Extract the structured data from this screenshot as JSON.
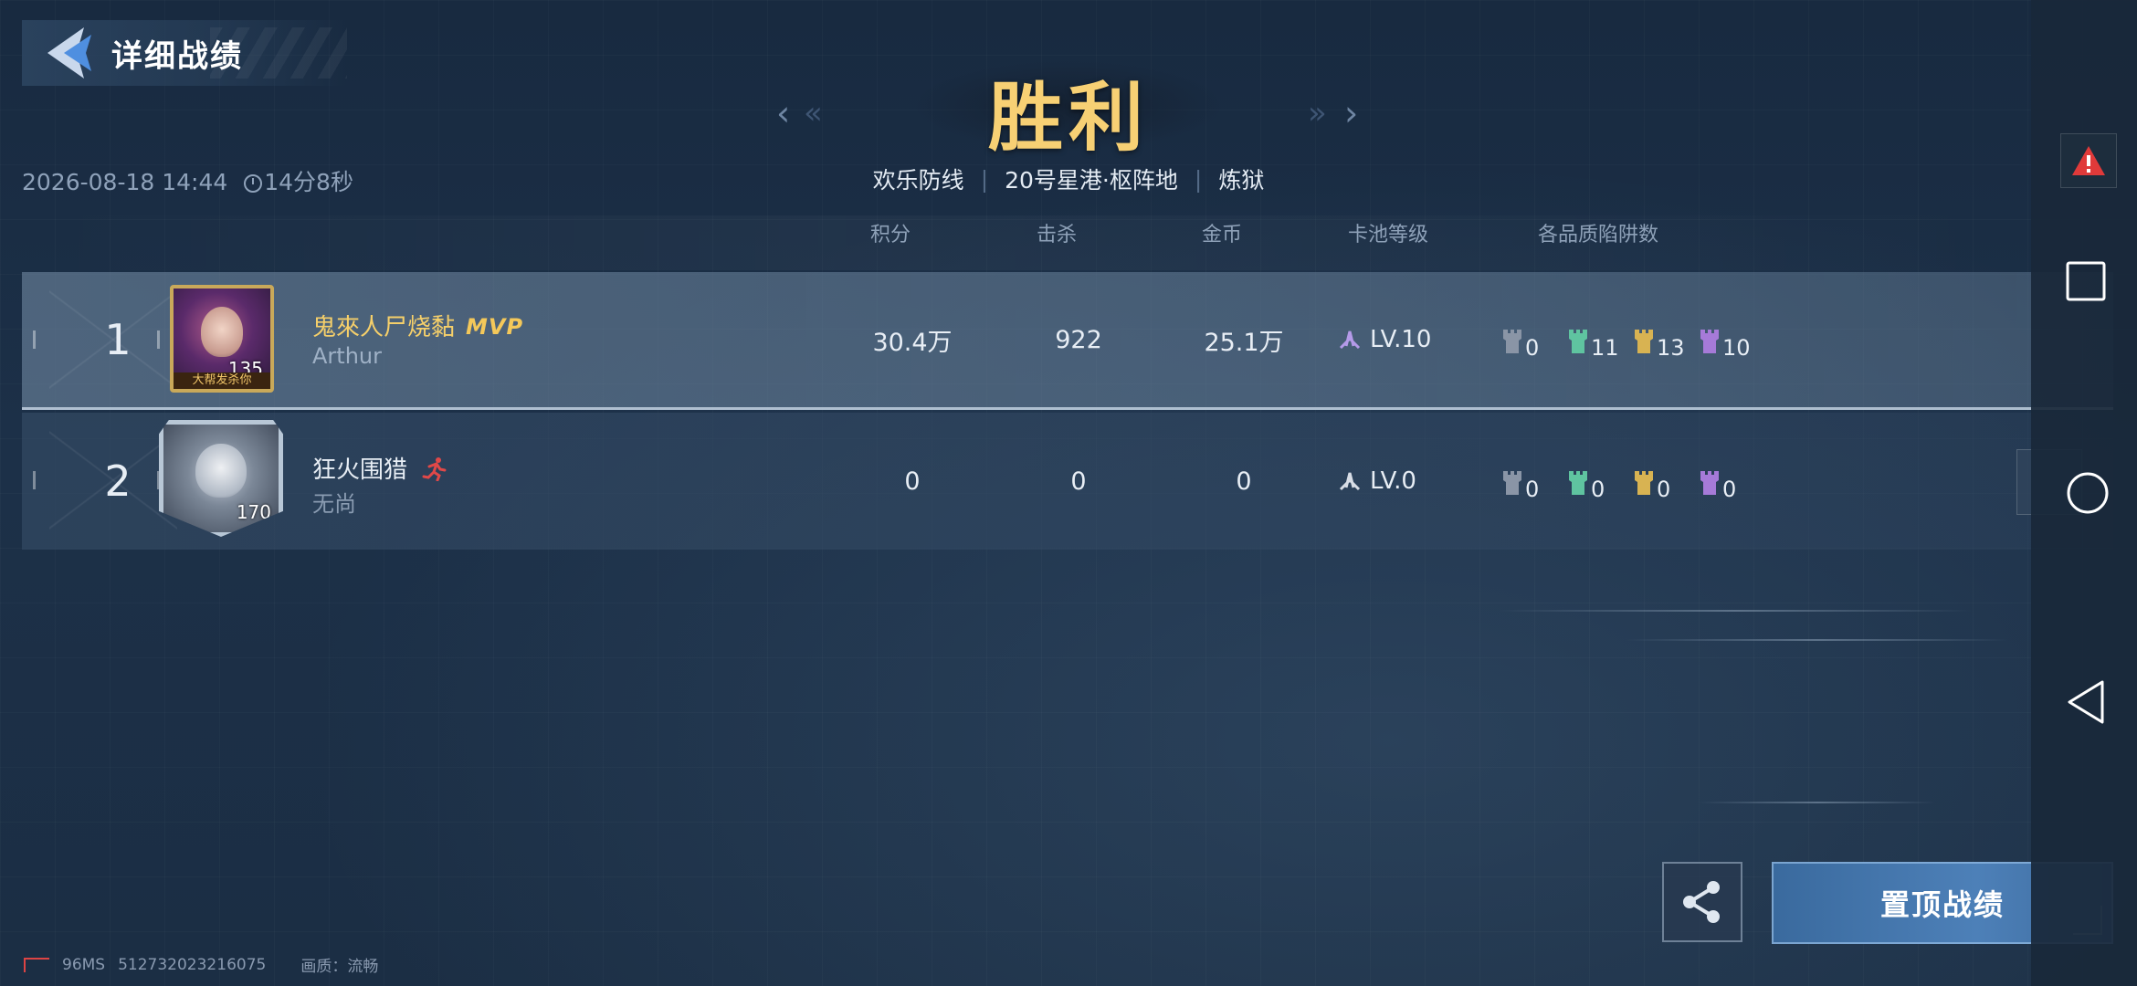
{
  "header": {
    "back_label": "详细战绩",
    "result": "胜利",
    "match_datetime": "2026-08-18 14:44",
    "duration": "14分8秒",
    "mode": "欢乐防线",
    "map": "20号星港·枢阵地",
    "difficulty": "炼狱"
  },
  "columns": {
    "score": "积分",
    "kills": "击杀",
    "gold": "金币",
    "pool_level": "卡池等级",
    "traps": "各品质陷阱数"
  },
  "players": [
    {
      "rank": "1",
      "name": "鬼來人尸烧黏",
      "badge": "MVP",
      "sub": "Arthur",
      "avatar_level": "135",
      "avatar_caption": "大帮发杀你",
      "score": "30.4万",
      "kills": "922",
      "gold": "25.1万",
      "pool_level": "LV.10",
      "traps": [
        "0",
        "11",
        "13",
        "10"
      ]
    },
    {
      "rank": "2",
      "name": "狂火围猎",
      "sub": "无尚",
      "avatar_level": "170",
      "score": "0",
      "kills": "0",
      "gold": "0",
      "pool_level": "LV.0",
      "traps": [
        "0",
        "0",
        "0",
        "0"
      ]
    }
  ],
  "trap_colors": [
    "#8a95a6",
    "#5fc4a0",
    "#d8b352",
    "#a67ad8"
  ],
  "buttons": {
    "pin_label": "置顶战绩"
  },
  "footer": {
    "ping": "96MS",
    "id": "512732023216075",
    "quality": "画质：流畅"
  },
  "icons": [
    "back-arrow-icon",
    "clock-icon",
    "run-icon",
    "pool-level-icon",
    "trap-tower-icon",
    "share-icon",
    "warning-icon",
    "square-icon",
    "circle-icon",
    "triangle-back-icon",
    "network-icon"
  ]
}
